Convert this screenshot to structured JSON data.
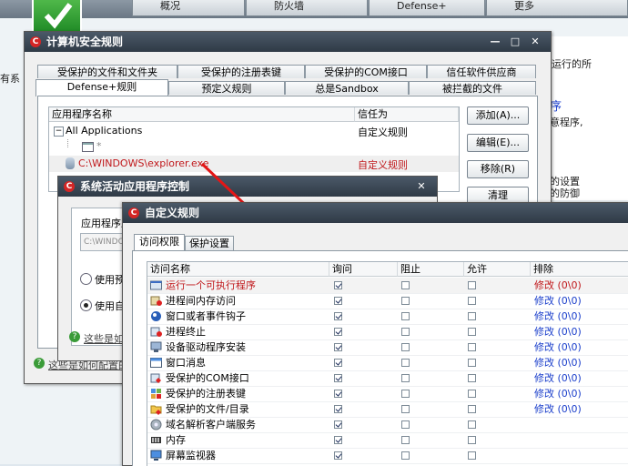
{
  "background": {
    "top_tabs": [
      "概况",
      "防火墙",
      "Defense+",
      "更多"
    ],
    "right_texts": [
      "运行的所",
      "序",
      "意程序,",
      "的设置",
      "的防御",
      "。"
    ],
    "left_text": "有系"
  },
  "computer_rules_window": {
    "title": "计算机安全规则",
    "tabs_row1": [
      "受保护的文件和文件夹",
      "受保护的注册表键",
      "受保护的COM接口",
      "信任软件供应商"
    ],
    "tabs_row2": [
      "Defense+规则",
      "预定义规则",
      "总是Sandbox",
      "被拦截的文件"
    ],
    "columns": [
      "应用程序名称",
      "信任为"
    ],
    "rows": [
      {
        "name": "All Applications",
        "trust": "自定义规则"
      },
      {
        "name": "*",
        "trust": ""
      },
      {
        "name": "C:\\WINDOWS\\explorer.exe",
        "trust": "自定义规则"
      }
    ],
    "buttons": {
      "add": "添加(A)...",
      "edit": "编辑(E)...",
      "remove": "移除(R)",
      "clear": "清理"
    },
    "footer_link": "这些是如何配置的"
  },
  "activity_window": {
    "title": "系统活动应用程序控制",
    "field_label": "应用程序路",
    "field_value": "C:\\WINDO",
    "radio_1": "使用预",
    "radio_2": "使用自",
    "help_link": "这些是如"
  },
  "custom_rules_window": {
    "title": "自定义规则",
    "tabs": [
      "访问权限",
      "保护设置"
    ],
    "columns": [
      "访问名称",
      "询问",
      "阻止",
      "允许",
      "排除"
    ],
    "rows": [
      {
        "name": "运行一个可执行程序",
        "icon": "exe-icon",
        "ask": true,
        "block": false,
        "allow": false,
        "exclude": "修改 (0\\0)",
        "highlight": true
      },
      {
        "name": "进程间内存访问",
        "icon": "memory-icon",
        "ask": true,
        "block": false,
        "allow": false,
        "exclude": "修改 (0\\0)"
      },
      {
        "name": "窗口或者事件钩子",
        "icon": "hook-icon",
        "ask": true,
        "block": false,
        "allow": false,
        "exclude": "修改 (0\\0)"
      },
      {
        "name": "进程终止",
        "icon": "terminate-icon",
        "ask": true,
        "block": false,
        "allow": false,
        "exclude": "修改 (0\\0)"
      },
      {
        "name": "设备驱动程序安装",
        "icon": "driver-icon",
        "ask": true,
        "block": false,
        "allow": false,
        "exclude": "修改 (0\\0)"
      },
      {
        "name": "窗口消息",
        "icon": "window-message-icon",
        "ask": true,
        "block": false,
        "allow": false,
        "exclude": "修改 (0\\0)"
      },
      {
        "name": "受保护的COM接口",
        "icon": "com-icon",
        "ask": true,
        "block": false,
        "allow": false,
        "exclude": "修改 (0\\0)"
      },
      {
        "name": "受保护的注册表键",
        "icon": "registry-icon",
        "ask": true,
        "block": false,
        "allow": false,
        "exclude": "修改 (0\\0)"
      },
      {
        "name": "受保护的文件/目录",
        "icon": "folder-icon",
        "ask": true,
        "block": false,
        "allow": false,
        "exclude": "修改 (0\\0)"
      },
      {
        "name": "域名解析客户端服务",
        "icon": "dns-icon",
        "ask": true,
        "block": false,
        "allow": false,
        "exclude": ""
      },
      {
        "name": "内存",
        "icon": "ram-icon",
        "ask": true,
        "block": false,
        "allow": false,
        "exclude": ""
      },
      {
        "name": "屏幕监视器",
        "icon": "monitor-icon",
        "ask": true,
        "block": false,
        "allow": false,
        "exclude": ""
      }
    ]
  },
  "colors": {
    "accent_red": "#c0171a",
    "link_blue": "#1a3ecb",
    "titlebar": "#35414e"
  }
}
